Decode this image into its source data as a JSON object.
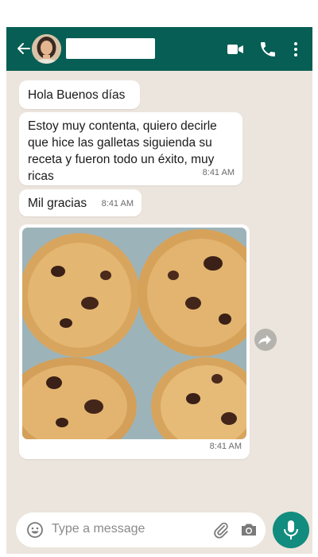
{
  "header": {
    "back_icon": "arrow-left-icon",
    "contact_name": "",
    "video_icon": "video-camera-icon",
    "call_icon": "phone-icon",
    "menu_icon": "more-vertical-icon",
    "color": "#075e54"
  },
  "messages": [
    {
      "text": "Hola Buenos días",
      "time": ""
    },
    {
      "text": "Estoy muy contenta, quiero decirle que hice las galletas siguienda su receta y fueron todo un éxito, muy ricas",
      "time": "8:41 AM"
    },
    {
      "text": "Mil gracias",
      "time": "8:41 AM"
    },
    {
      "image": "chocolate-chip-cookies-photo",
      "time": "8:41 AM"
    }
  ],
  "composer": {
    "placeholder": "Type a message",
    "emoji_icon": "emoji-icon",
    "attach_icon": "paperclip-icon",
    "camera_icon": "camera-icon",
    "mic_icon": "microphone-icon",
    "accent": "#128c7e"
  },
  "chat_background": "#ece5dd"
}
